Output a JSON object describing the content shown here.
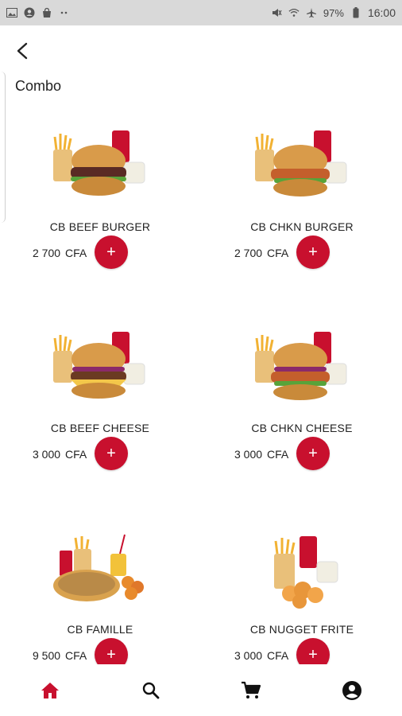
{
  "status_bar": {
    "battery": "97%",
    "time": "16:00"
  },
  "header": {
    "title": "Combo"
  },
  "products": [
    {
      "name": "CB BEEF BURGER",
      "price": "2 700",
      "currency": "CFA",
      "image": "burger-combo-icon",
      "add_label": "+"
    },
    {
      "name": "CB CHKN BURGER",
      "price": "2 700",
      "currency": "CFA",
      "image": "chicken-burger-combo-icon",
      "add_label": "+"
    },
    {
      "name": "CB BEEF CHEESE",
      "price": "3 000",
      "currency": "CFA",
      "image": "cheese-burger-combo-icon",
      "add_label": "+"
    },
    {
      "name": "CB CHKN CHEESE",
      "price": "3 000",
      "currency": "CFA",
      "image": "chicken-cheese-combo-icon",
      "add_label": "+"
    },
    {
      "name": "CB FAMILLE",
      "price": "9 500",
      "currency": "CFA",
      "image": "family-pizza-combo-icon",
      "add_label": "+"
    },
    {
      "name": "CB NUGGET FRITE",
      "price": "3 000",
      "currency": "CFA",
      "image": "nugget-fries-combo-icon",
      "add_label": "+"
    }
  ],
  "bottom_nav": [
    {
      "name": "home",
      "icon": "home-icon",
      "active": true
    },
    {
      "name": "search",
      "icon": "search-icon",
      "active": false
    },
    {
      "name": "cart",
      "icon": "cart-icon",
      "active": false
    },
    {
      "name": "account",
      "icon": "account-icon",
      "active": false
    }
  ],
  "colors": {
    "accent": "#c8102e",
    "status_bar": "#d9d9d9",
    "text": "#222222"
  }
}
